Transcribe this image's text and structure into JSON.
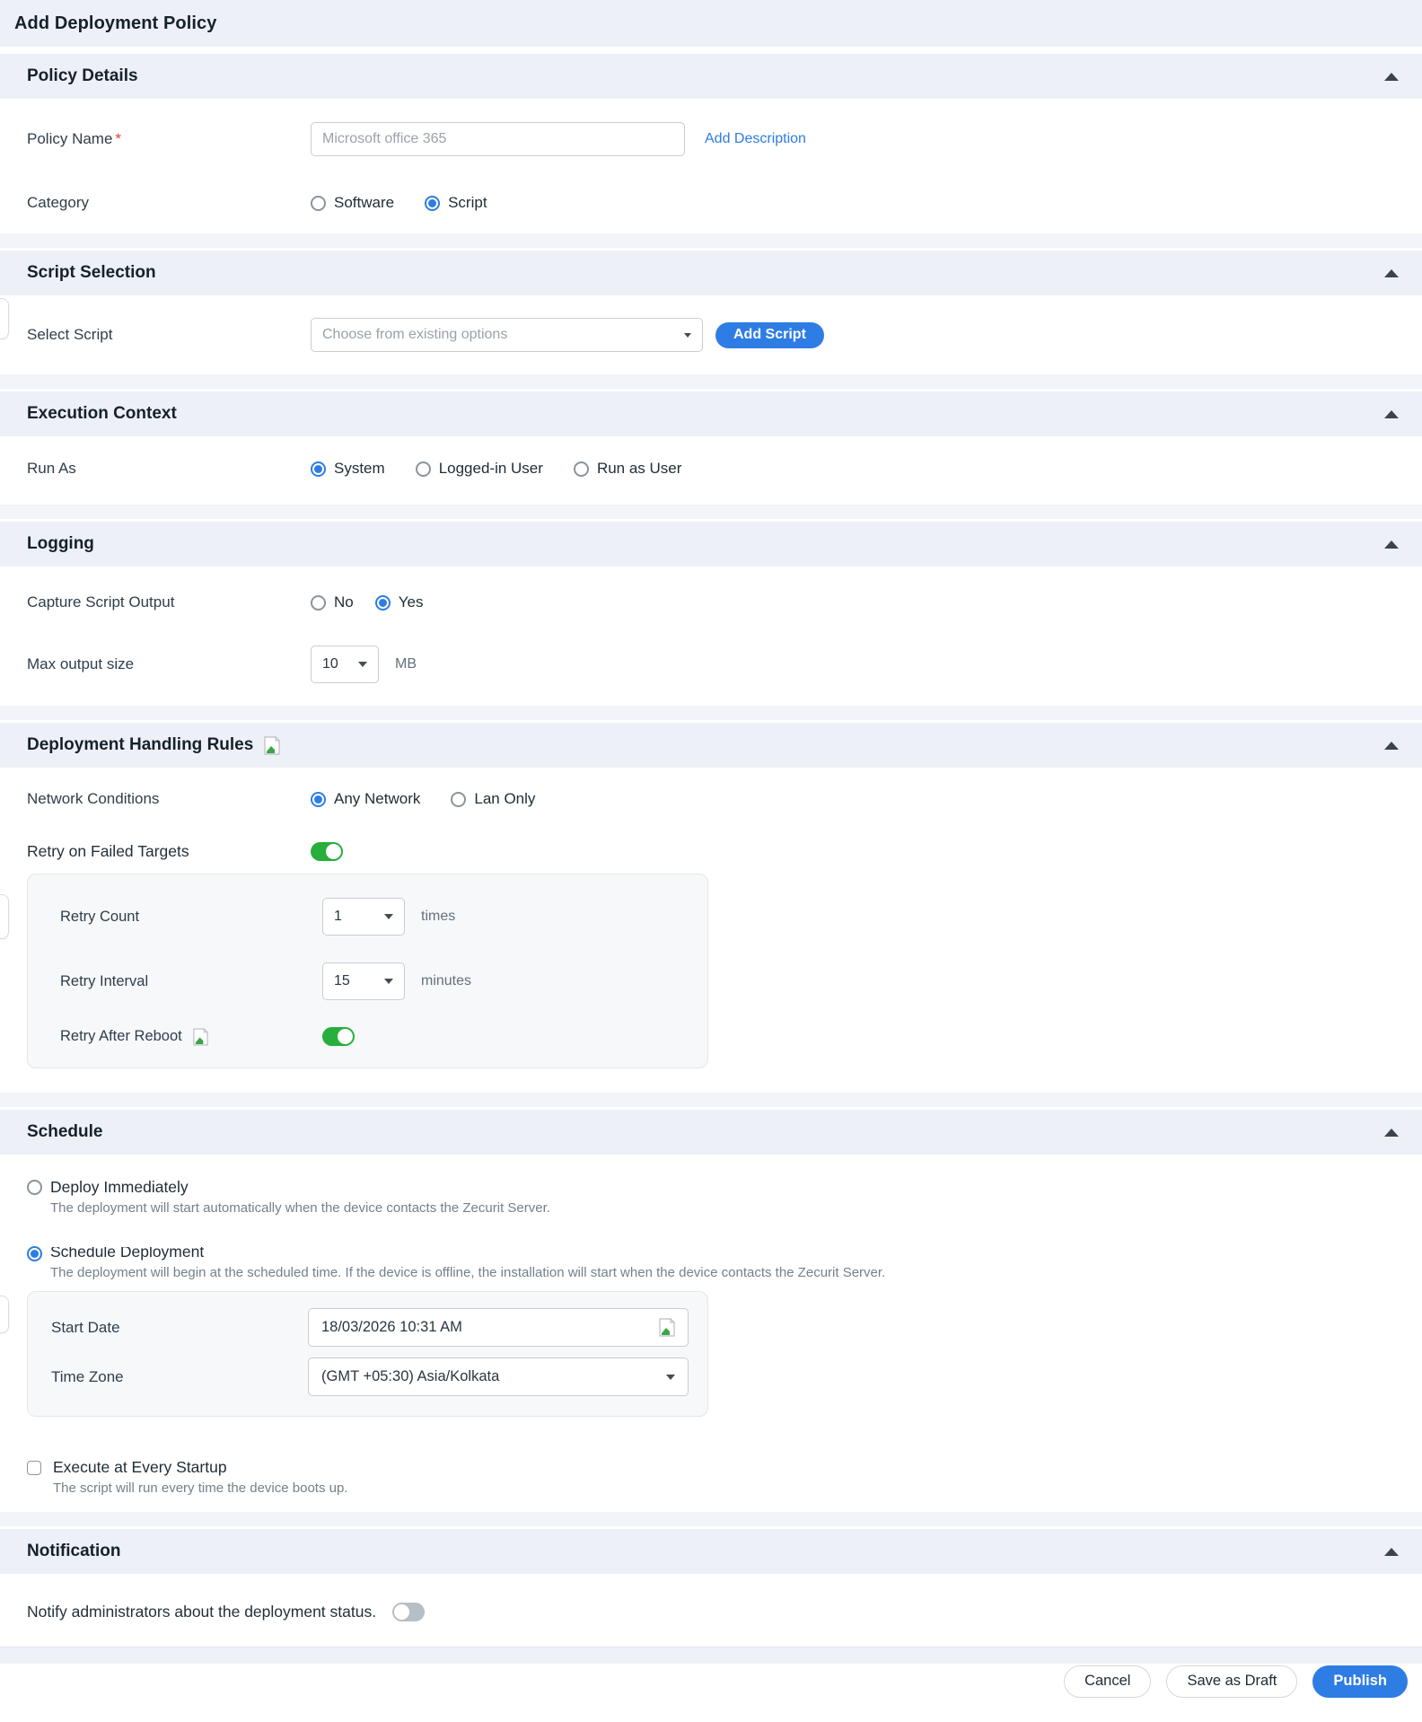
{
  "header": {
    "title": "Add Deployment Policy"
  },
  "sections": {
    "policy_details": {
      "title": "Policy Details",
      "policy_name": {
        "label": "Policy Name",
        "required": "*",
        "placeholder": "Microsoft office 365"
      },
      "add_description": "Add Description",
      "category": {
        "label": "Category",
        "options": [
          {
            "label": "Software",
            "selected": false
          },
          {
            "label": "Script",
            "selected": true
          }
        ]
      }
    },
    "script_selection": {
      "title": "Script Selection",
      "select_script": {
        "label": "Select Script",
        "value": "Choose from existing options"
      },
      "add_script_button": "Add Script"
    },
    "execution_context": {
      "title": "Execution Context",
      "run_as": {
        "label": "Run As",
        "options": [
          {
            "label": "System",
            "selected": true
          },
          {
            "label": "Logged-in User",
            "selected": false
          },
          {
            "label": "Run as User",
            "selected": false
          }
        ]
      }
    },
    "logging": {
      "title": "Logging",
      "capture_output": {
        "label": "Capture Script Output",
        "options": [
          {
            "label": "No",
            "selected": false
          },
          {
            "label": "Yes",
            "selected": true
          }
        ]
      },
      "max_output": {
        "label": "Max output size",
        "value": "10",
        "unit": "MB"
      }
    },
    "deployment_handling": {
      "title": "Deployment Handling Rules",
      "network_conditions": {
        "label": "Network Conditions",
        "options": [
          {
            "label": "Any Network",
            "selected": true
          },
          {
            "label": "Lan Only",
            "selected": false
          }
        ]
      },
      "retry_on_failed": {
        "label": "Retry on Failed Targets",
        "enabled": true
      },
      "retry_count": {
        "label": "Retry Count",
        "value": "1",
        "unit": "times"
      },
      "retry_interval": {
        "label": "Retry Interval",
        "value": "15",
        "unit": "minutes"
      },
      "retry_after_reboot": {
        "label": "Retry After Reboot",
        "enabled": true
      }
    },
    "schedule": {
      "title": "Schedule",
      "deploy_immediately": {
        "label": "Deploy Immediately",
        "description": "The deployment will start automatically when the device contacts the Zecurit Server.",
        "selected": false
      },
      "schedule_deployment": {
        "label": "Schedule Deployment",
        "description": "The deployment will begin at the scheduled time. If the device is offline, the installation will start when the device contacts the Zecurit Server.",
        "selected": true
      },
      "start_date": {
        "label": "Start Date",
        "value": "18/03/2026 10:31 AM"
      },
      "time_zone": {
        "label": "Time Zone",
        "value": "(GMT +05:30) Asia/Kolkata"
      },
      "execute_at_startup": {
        "label": "Execute at Every Startup",
        "description": "The script will run every time the device boots up.",
        "checked": false
      }
    },
    "notification": {
      "title": "Notification",
      "notify": {
        "label": "Notify administrators about the deployment status.",
        "enabled": false
      }
    }
  },
  "footer": {
    "cancel": "Cancel",
    "save_as_draft": "Save as Draft",
    "publish": "Publish"
  },
  "colors": {
    "accent_blue": "#2e7de4",
    "toggle_green": "#27ae3c",
    "section_header_bg": "#edf1f7",
    "panel_bg": "#f7f8fa",
    "required_red": "#e0413a"
  }
}
